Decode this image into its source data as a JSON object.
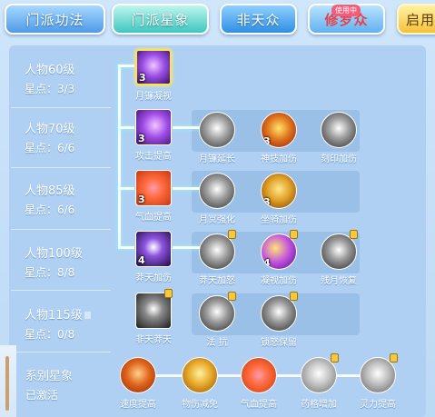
{
  "tabs": {
    "skill": "门派功法",
    "star": "门派星象",
    "feitian": "非天众",
    "xiuluo": "修罗众",
    "in_use_badge": "使用中",
    "enable": "启用"
  },
  "rows": [
    {
      "level": "人物60级",
      "points": "星点：3/3"
    },
    {
      "level": "人物70级",
      "points": "星点：6/6"
    },
    {
      "level": "人物85级",
      "points": "星点：6/6"
    },
    {
      "level": "人物100级",
      "points": "星点：8/8"
    },
    {
      "level": "人物115级",
      "points": "星点：0/8"
    }
  ],
  "nodes": {
    "r1": [
      {
        "label": "月镰凝视",
        "num": "3"
      }
    ],
    "r2": [
      {
        "label": "攻击提高",
        "num": "3"
      },
      {
        "label": "月镰延长",
        "num": ""
      },
      {
        "label": "神技加伤",
        "num": "3"
      },
      {
        "label": "刻印加伤",
        "num": ""
      }
    ],
    "r3": [
      {
        "label": "气血提高",
        "num": "3"
      },
      {
        "label": "月冥强化",
        "num": ""
      },
      {
        "label": "坐骑加伤",
        "num": "3"
      }
    ],
    "r4": [
      {
        "label": "莽天加伤",
        "num": "4"
      },
      {
        "label": "莽天加怒",
        "num": ""
      },
      {
        "label": "凝视加伤",
        "num": "4"
      },
      {
        "label": "残月恢复",
        "num": ""
      }
    ],
    "r5": [
      {
        "label": "非天莽天",
        "num": ""
      },
      {
        "label": "法 抗",
        "num": ""
      },
      {
        "label": "锁怒保留",
        "num": ""
      }
    ]
  },
  "series": {
    "title": "系别星象",
    "status": "已激活",
    "items": [
      "速度提高",
      "物伤减免",
      "气血提高",
      "药格增加",
      "灵力提高"
    ]
  },
  "icons": {
    "lock": "lock-icon"
  },
  "colors": {
    "accent_star_tab": "#3fc6c0",
    "xiuluo_text": "#e8404a",
    "selected_border": "#ffe14a"
  }
}
